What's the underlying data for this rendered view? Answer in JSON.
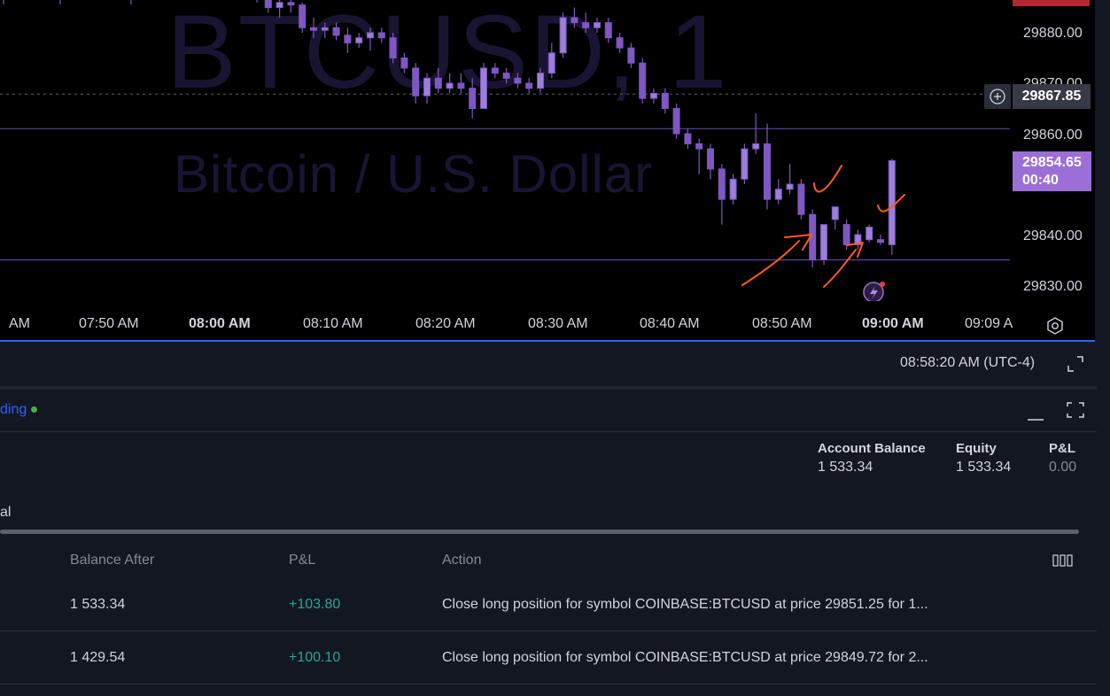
{
  "chart": {
    "watermark_symbol": "BTCUSD, 1",
    "watermark_name": "Bitcoin / U.S. Dollar",
    "price_axis": [
      "29880.00",
      "29870.00",
      "29860.00",
      "29840.00",
      "29830.00"
    ],
    "crosshair_price": "29867.85",
    "last_price": "29854.65",
    "countdown": "00:40",
    "time_axis": [
      "AM",
      "07:50 AM",
      "08:00 AM",
      "08:10 AM",
      "08:20 AM",
      "08:30 AM",
      "08:40 AM",
      "08:50 AM",
      "09:00 AM",
      "09:09 A"
    ],
    "colors": {
      "candle": "#7e57c2",
      "line": "#5b3fa8",
      "annotation": "#ff5c1a",
      "last_price_bg": "#9b6fd6"
    }
  },
  "chart_data": {
    "type": "candlestick",
    "symbol": "BTCUSD",
    "interval": "1",
    "ylim": [
      29825.0,
      29890.0
    ],
    "horizontal_lines": [
      29861.0,
      29835.0
    ],
    "candles": [
      {
        "o": 29889.0,
        "h": 29891.0,
        "l": 29886.0,
        "c": 29887.0
      },
      {
        "o": 29887.0,
        "h": 29889.0,
        "l": 29884.0,
        "c": 29885.0
      },
      {
        "o": 29885.0,
        "h": 29887.0,
        "l": 29883.0,
        "c": 29886.0
      },
      {
        "o": 29886.0,
        "h": 29887.0,
        "l": 29884.0,
        "c": 29885.5
      },
      {
        "o": 29885.5,
        "h": 29886.0,
        "l": 29880.0,
        "c": 29881.0
      },
      {
        "o": 29881.0,
        "h": 29883.0,
        "l": 29879.0,
        "c": 29880.5
      },
      {
        "o": 29880.5,
        "h": 29882.0,
        "l": 29879.0,
        "c": 29881.0
      },
      {
        "o": 29881.0,
        "h": 29882.0,
        "l": 29878.5,
        "c": 29879.5
      },
      {
        "o": 29879.5,
        "h": 29881.0,
        "l": 29876.0,
        "c": 29878.0
      },
      {
        "o": 29878.0,
        "h": 29880.0,
        "l": 29877.0,
        "c": 29879.0
      },
      {
        "o": 29879.0,
        "h": 29881.0,
        "l": 29876.5,
        "c": 29880.0
      },
      {
        "o": 29880.0,
        "h": 29881.0,
        "l": 29878.0,
        "c": 29879.0
      },
      {
        "o": 29879.0,
        "h": 29880.0,
        "l": 29874.0,
        "c": 29875.0
      },
      {
        "o": 29875.0,
        "h": 29876.0,
        "l": 29872.0,
        "c": 29873.0
      },
      {
        "o": 29873.0,
        "h": 29874.0,
        "l": 29866.0,
        "c": 29867.5
      },
      {
        "o": 29867.5,
        "h": 29872.0,
        "l": 29866.0,
        "c": 29871.0
      },
      {
        "o": 29871.0,
        "h": 29873.0,
        "l": 29868.0,
        "c": 29869.0
      },
      {
        "o": 29869.0,
        "h": 29872.0,
        "l": 29868.0,
        "c": 29870.0
      },
      {
        "o": 29870.0,
        "h": 29872.0,
        "l": 29868.0,
        "c": 29869.0
      },
      {
        "o": 29869.0,
        "h": 29871.0,
        "l": 29863.0,
        "c": 29865.0
      },
      {
        "o": 29865.0,
        "h": 29874.0,
        "l": 29865.0,
        "c": 29873.0
      },
      {
        "o": 29873.0,
        "h": 29874.0,
        "l": 29871.0,
        "c": 29872.0
      },
      {
        "o": 29872.0,
        "h": 29873.0,
        "l": 29870.0,
        "c": 29871.0
      },
      {
        "o": 29871.0,
        "h": 29872.0,
        "l": 29869.0,
        "c": 29870.0
      },
      {
        "o": 29870.0,
        "h": 29871.0,
        "l": 29868.0,
        "c": 29869.0
      },
      {
        "o": 29869.0,
        "h": 29873.0,
        "l": 29868.0,
        "c": 29872.0
      },
      {
        "o": 29872.0,
        "h": 29878.0,
        "l": 29871.0,
        "c": 29876.0
      },
      {
        "o": 29876.0,
        "h": 29884.0,
        "l": 29875.0,
        "c": 29883.0
      },
      {
        "o": 29883.0,
        "h": 29885.0,
        "l": 29881.0,
        "c": 29882.0
      },
      {
        "o": 29882.0,
        "h": 29884.0,
        "l": 29880.0,
        "c": 29881.0
      },
      {
        "o": 29881.0,
        "h": 29883.0,
        "l": 29880.0,
        "c": 29882.0
      },
      {
        "o": 29882.0,
        "h": 29883.0,
        "l": 29878.0,
        "c": 29879.0
      },
      {
        "o": 29879.0,
        "h": 29880.0,
        "l": 29876.0,
        "c": 29877.0
      },
      {
        "o": 29877.0,
        "h": 29878.0,
        "l": 29873.0,
        "c": 29874.0
      },
      {
        "o": 29874.0,
        "h": 29875.0,
        "l": 29866.0,
        "c": 29867.0
      },
      {
        "o": 29867.0,
        "h": 29869.0,
        "l": 29866.0,
        "c": 29868.0
      },
      {
        "o": 29868.0,
        "h": 29869.0,
        "l": 29864.0,
        "c": 29865.0
      },
      {
        "o": 29865.0,
        "h": 29866.0,
        "l": 29859.0,
        "c": 29860.0
      },
      {
        "o": 29860.0,
        "h": 29861.0,
        "l": 29857.0,
        "c": 29858.0
      },
      {
        "o": 29858.0,
        "h": 29859.0,
        "l": 29852.0,
        "c": 29857.0
      },
      {
        "o": 29857.0,
        "h": 29858.0,
        "l": 29851.0,
        "c": 29853.0
      },
      {
        "o": 29853.0,
        "h": 29854.0,
        "l": 29842.0,
        "c": 29847.0
      },
      {
        "o": 29847.0,
        "h": 29852.0,
        "l": 29846.0,
        "c": 29851.0
      },
      {
        "o": 29851.0,
        "h": 29858.0,
        "l": 29850.0,
        "c": 29857.0
      },
      {
        "o": 29857.0,
        "h": 29864.0,
        "l": 29856.0,
        "c": 29858.0
      },
      {
        "o": 29858.0,
        "h": 29862.0,
        "l": 29845.0,
        "c": 29847.0
      },
      {
        "o": 29847.0,
        "h": 29851.0,
        "l": 29846.0,
        "c": 29849.0
      },
      {
        "o": 29849.0,
        "h": 29854.0,
        "l": 29848.0,
        "c": 29850.0
      },
      {
        "o": 29850.0,
        "h": 29851.0,
        "l": 29843.0,
        "c": 29844.0
      },
      {
        "o": 29844.0,
        "h": 29845.0,
        "l": 29833.5,
        "c": 29835.0
      },
      {
        "o": 29835.0,
        "h": 29842.0,
        "l": 29834.0,
        "c": 29842.0
      },
      {
        "o": 29843.0,
        "h": 29845.0,
        "l": 29841.0,
        "c": 29845.5
      },
      {
        "o": 29842.0,
        "h": 29843.0,
        "l": 29837.0,
        "c": 29838.0
      },
      {
        "o": 29838.0,
        "h": 29841.0,
        "l": 29837.0,
        "c": 29840.0
      },
      {
        "o": 29839.0,
        "h": 29842.0,
        "l": 29838.5,
        "c": 29841.5
      },
      {
        "o": 29839.0,
        "h": 29840.0,
        "l": 29838.0,
        "c": 29838.5
      },
      {
        "o": 29838.0,
        "h": 29855.0,
        "l": 29836.0,
        "c": 29854.65
      }
    ]
  },
  "timebar": {
    "clock": "08:58:20 AM (UTC-4)"
  },
  "panel": {
    "tab_partial": "ding",
    "tab2_partial": "al",
    "account_balance_label": "Account Balance",
    "account_balance_value": "1 533.34",
    "equity_label": "Equity",
    "equity_value": "1 533.34",
    "pnl_label": "P&L",
    "pnl_value": "0.00",
    "columns": {
      "balance_after": "Balance After",
      "pnl": "P&L",
      "action": "Action"
    },
    "rows": [
      {
        "balance_after": "1 533.34",
        "pnl": "+103.80",
        "action": "Close long position for symbol COINBASE:BTCUSD at price 29851.25 for 1..."
      },
      {
        "balance_after": "1 429.54",
        "pnl": "+100.10",
        "action": "Close long position for symbol COINBASE:BTCUSD at price 29849.72 for 2..."
      }
    ]
  }
}
